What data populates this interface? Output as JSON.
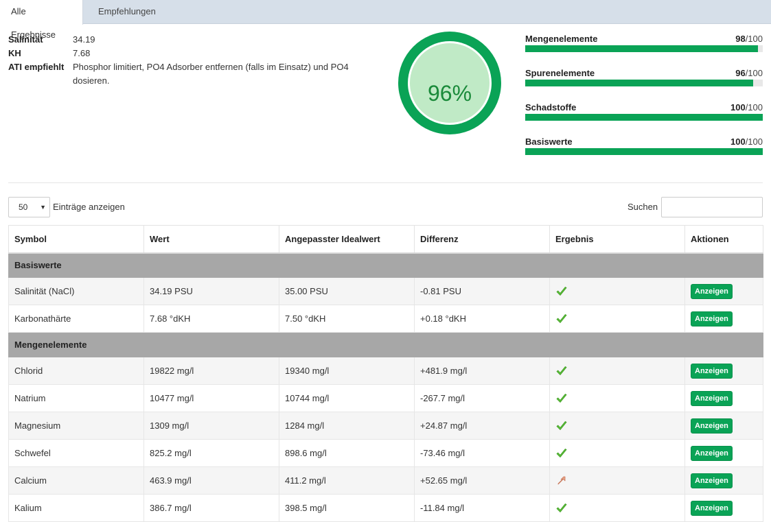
{
  "tabs": [
    {
      "label": "Alle Ergebnisse",
      "active": true
    },
    {
      "label": "Empfehlungen",
      "active": false
    }
  ],
  "summary": [
    {
      "key": "Salinität",
      "value": "34.19"
    },
    {
      "key": "KH",
      "value": "7.68"
    },
    {
      "key": "ATI empfiehlt",
      "value": "Phosphor limitiert, PO4 Adsorber entfernen (falls im Einsatz) und PO4 dosieren."
    }
  ],
  "gauge": {
    "value": 96,
    "label": "96%",
    "color": "#0aa356",
    "inner_color": "#c0eac6"
  },
  "categories": [
    {
      "label": "Mengenelemente",
      "score": "98",
      "max": "/100",
      "value": 98
    },
    {
      "label": "Spurenelemente",
      "score": "96",
      "max": "/100",
      "value": 96
    },
    {
      "label": "Schadstoffe",
      "score": "100",
      "max": "/100",
      "value": 100
    },
    {
      "label": "Basiswerte",
      "score": "100",
      "max": "/100",
      "value": 100
    }
  ],
  "controls": {
    "page_length": "50",
    "page_length_label": "Einträge anzeigen",
    "search_label": "Suchen",
    "search_value": ""
  },
  "table": {
    "headers": [
      "Symbol",
      "Wert",
      "Angepasster Idealwert",
      "Differenz",
      "Ergebnis",
      "Aktionen"
    ],
    "action_label": "Anzeigen",
    "groups": [
      {
        "name": "Basiswerte",
        "rows": [
          {
            "symbol": "Salinität (NaCl)",
            "value": "34.19 PSU",
            "ideal": "35.00 PSU",
            "diff": "-0.81 PSU",
            "result": "ok"
          },
          {
            "symbol": "Karbonathärte",
            "value": "7.68 °dKH",
            "ideal": "7.50 °dKH",
            "diff": "+0.18 °dKH",
            "result": "ok"
          }
        ]
      },
      {
        "name": "Mengenelemente",
        "rows": [
          {
            "symbol": "Chlorid",
            "value": "19822 mg/l",
            "ideal": "19340 mg/l",
            "diff": "+481.9 mg/l",
            "result": "ok"
          },
          {
            "symbol": "Natrium",
            "value": "10477 mg/l",
            "ideal": "10744 mg/l",
            "diff": "-267.7 mg/l",
            "result": "ok"
          },
          {
            "symbol": "Magnesium",
            "value": "1309 mg/l",
            "ideal": "1284 mg/l",
            "diff": "+24.87 mg/l",
            "result": "ok"
          },
          {
            "symbol": "Schwefel",
            "value": "825.2 mg/l",
            "ideal": "898.6 mg/l",
            "diff": "-73.46 mg/l",
            "result": "ok"
          },
          {
            "symbol": "Calcium",
            "value": "463.9 mg/l",
            "ideal": "411.2 mg/l",
            "diff": "+52.65 mg/l",
            "result": "high"
          },
          {
            "symbol": "Kalium",
            "value": "386.7 mg/l",
            "ideal": "398.5 mg/l",
            "diff": "-11.84 mg/l",
            "result": "ok"
          }
        ]
      }
    ]
  }
}
